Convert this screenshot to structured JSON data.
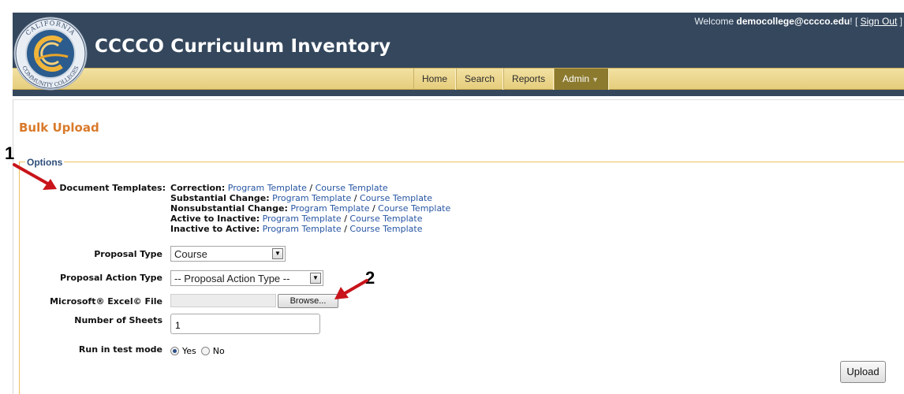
{
  "header": {
    "app_title": "CCCCO Curriculum Inventory",
    "welcome_prefix": "Welcome ",
    "user_email": "democollege@cccco.edu",
    "welcome_suffix": "! [ ",
    "sign_out": "Sign Out",
    "welcome_close": " ]",
    "logo_text_top": "CALIFORNIA",
    "logo_text_bottom": "COMMUNITY COLLEGES"
  },
  "nav": {
    "items": [
      "Home",
      "Search",
      "Reports",
      "Admin"
    ],
    "active": "Admin"
  },
  "page": {
    "title": "Bulk Upload",
    "fieldset_legend": "Options"
  },
  "templates": {
    "label": "Document Templates:",
    "rows": [
      {
        "type": "Correction:",
        "program": "Program Template",
        "sep": " / ",
        "course": "Course Template"
      },
      {
        "type": "Substantial Change:",
        "program": "Program Template",
        "sep": " / ",
        "course": "Course Template"
      },
      {
        "type": "Nonsubstantial Change:",
        "program": "Program Template",
        "sep": " / ",
        "course": "Course Template"
      },
      {
        "type": "Active to Inactive:",
        "program": "Program Template",
        "sep": " / ",
        "course": "Course Template"
      },
      {
        "type": "Inactive to Active:",
        "program": "Program Template",
        "sep": " / ",
        "course": "Course Template"
      }
    ]
  },
  "form": {
    "proposal_type_label": "Proposal Type",
    "proposal_type_value": "Course",
    "proposal_action_label": "Proposal Action Type",
    "proposal_action_value": "-- Proposal Action Type --",
    "excel_file_label": "Microsoft® Excel© File",
    "browse_label": "Browse...",
    "sheets_label": "Number of Sheets",
    "sheets_value": "1",
    "test_mode_label": "Run in test mode",
    "test_mode_yes": "Yes",
    "test_mode_no": "No",
    "test_mode_selected": "Yes",
    "upload_label": "Upload"
  },
  "annotations": {
    "marker_1": "1",
    "marker_2": "2",
    "arrow_color": "#c8141a"
  },
  "colors": {
    "header_bg": "#34475d",
    "nav_bar": "#e6cd7c",
    "active_nav": "#8c7a2e",
    "page_title": "#d97a2a",
    "legend": "#2e4e79",
    "link": "#2756a3",
    "fieldset_border": "#f0c060"
  }
}
